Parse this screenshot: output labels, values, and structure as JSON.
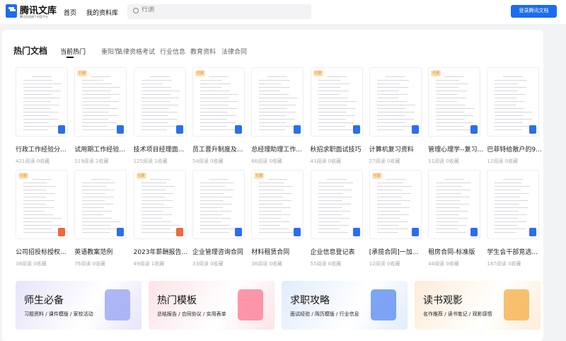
{
  "header": {
    "brand": "腾讯文库",
    "brand_sub": "腾讯文档旗下内容平台",
    "nav": [
      "首页",
      "我的资料库"
    ],
    "search_placeholder": "行测",
    "login": "登录腾讯文档"
  },
  "section": {
    "title": "热门文档",
    "tabs": [
      "当前热门",
      "重阳节",
      "法律资格考试",
      "行业信息",
      "教育资料",
      "法律合同"
    ],
    "active_tab": 0
  },
  "docs": [
    {
      "title": "行政工作经验分...",
      "stats": "421阅读 0收藏",
      "badge": "",
      "type": "word"
    },
    {
      "title": "试用期工作经验...",
      "stats": "119阅读 2收藏",
      "badge": "付费",
      "type": "word"
    },
    {
      "title": "技术项目经理面...",
      "stats": "125阅读 1收藏",
      "badge": "",
      "type": "word"
    },
    {
      "title": "员工晋升制度及...",
      "stats": "54阅读 0收藏",
      "badge": "付费",
      "type": "word"
    },
    {
      "title": "总经理助理工作...",
      "stats": "66阅读 0收藏",
      "badge": "",
      "type": "word"
    },
    {
      "title": "秋招求职面试技巧",
      "stats": "41阅读 0收藏",
      "badge": "付费",
      "type": "word"
    },
    {
      "title": "计算机复习资料",
      "stats": "27阅读 0收藏",
      "badge": "",
      "type": "word"
    },
    {
      "title": "管理心理学--复习...",
      "stats": "11阅读 0收藏",
      "badge": "付费",
      "type": "word"
    },
    {
      "title": "巴菲特给散户的9...",
      "stats": "12阅读 0收藏",
      "badge": "",
      "type": "word"
    },
    {
      "title": "公司招投标授权...",
      "stats": "38阅读 0收藏",
      "badge": "付费",
      "type": "pdf"
    },
    {
      "title": "英语教案范例",
      "stats": "76阅读 0收藏",
      "badge": "",
      "type": "word"
    },
    {
      "title": "2023年薪酬报告...",
      "stats": "49阅读 1收藏",
      "badge": "付费",
      "type": "pdf"
    },
    {
      "title": "企业管理咨询合同",
      "stats": "33阅读 0收藏",
      "badge": "",
      "type": "word"
    },
    {
      "title": "材料租赁合同",
      "stats": "38阅读 0收藏",
      "badge": "付费",
      "type": "word"
    },
    {
      "title": "企业信息登记表",
      "stats": "55阅读 0收藏",
      "badge": "",
      "type": "word"
    },
    {
      "title": "[承揽合同]一加...",
      "stats": "12阅读 0收藏",
      "badge": "付费",
      "type": "word"
    },
    {
      "title": "租房合同-标准版",
      "stats": "44阅读 0收藏",
      "badge": "",
      "type": "word"
    },
    {
      "title": "学生会干部竞选...",
      "stats": "187阅读 0收藏",
      "badge": "",
      "type": "word"
    }
  ],
  "banners": [
    {
      "title": "师生必备",
      "sub": "习题资料 / 课件模版 / 家校活动",
      "bg": "#e6e4fb",
      "art": "#9aa6f4"
    },
    {
      "title": "热门模板",
      "sub": "总结报告 / 合同协议 / 实用表单",
      "bg": "#fde3e8",
      "art": "#fb7d93"
    },
    {
      "title": "求职攻略",
      "sub": "面试经验 / 简历模版 / 行业信息",
      "bg": "#e1ecfd",
      "art": "#5f8ff1"
    },
    {
      "title": "读书观影",
      "sub": "名作推荐 / 读书笔记 / 观影感悟",
      "bg": "#fdecd9",
      "art": "#f6b04c"
    }
  ]
}
